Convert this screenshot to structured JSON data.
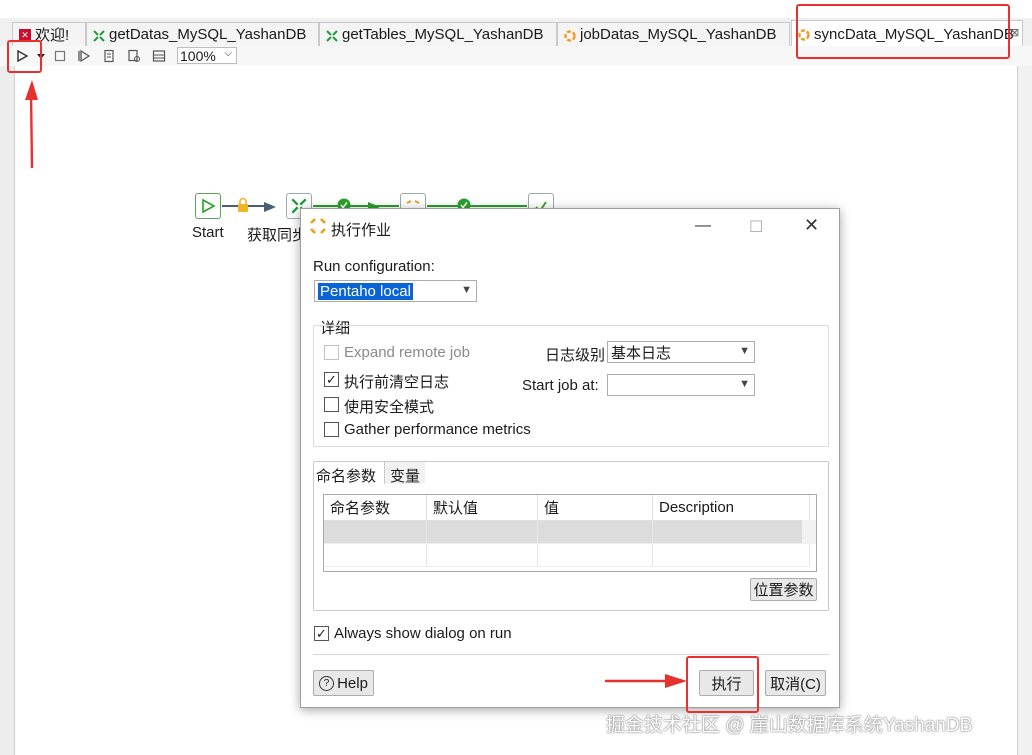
{
  "tabs": [
    {
      "label": "欢迎!",
      "icon": "welcome-icon",
      "active": false
    },
    {
      "label": "getDatas_MySQL_YashanDB",
      "icon": "transformation-icon",
      "active": false
    },
    {
      "label": "getTables_MySQL_YashanDB",
      "icon": "transformation-icon",
      "active": false
    },
    {
      "label": "jobDatas_MySQL_YashanDB",
      "icon": "job-icon",
      "active": false
    },
    {
      "label": "syncData_MySQL_YashanDB",
      "icon": "job-icon",
      "active": true
    }
  ],
  "toolbar": {
    "zoom": "100%",
    "icons": [
      "run-icon",
      "dropdown-icon",
      "stop-icon",
      "replay-icon",
      "verify-icon",
      "sql-icon",
      "explore-icon"
    ]
  },
  "canvas": {
    "nodes": [
      {
        "label": "Start",
        "icon": "start-icon"
      },
      {
        "label": "获取同步",
        "icon": "transformation-icon"
      },
      {
        "label": "",
        "icon": "job-icon"
      },
      {
        "label": "",
        "icon": "success-icon"
      }
    ]
  },
  "dialog": {
    "title": "执行作业",
    "run_config_label": "Run configuration:",
    "run_config_value": "Pentaho local",
    "details_legend": "详细",
    "expand_remote": "Expand remote job",
    "clear_log": "执行前清空日志",
    "safe_mode": "使用安全模式",
    "gather_metrics": "Gather performance metrics",
    "log_level_label": "日志级别",
    "log_level_value": "基本日志",
    "start_job_label": "Start job at:",
    "start_job_value": "",
    "tab_named_params": "命名参数",
    "tab_variables": "变量",
    "columns": [
      "命名参数",
      "默认值",
      "值",
      "Description"
    ],
    "position_params_button": "位置参数",
    "always_show": "Always show dialog on run",
    "help_button": "Help",
    "run_button": "执行",
    "cancel_button": "取消(C)"
  },
  "watermark": "掘金技术社区 @ 崖山数据库系统YashanDB",
  "colors": {
    "highlight": "#e8312f",
    "selection": "#0a64d6",
    "hop_ok": "#2aa12a",
    "hop_unconditional": "#4a5e78"
  }
}
